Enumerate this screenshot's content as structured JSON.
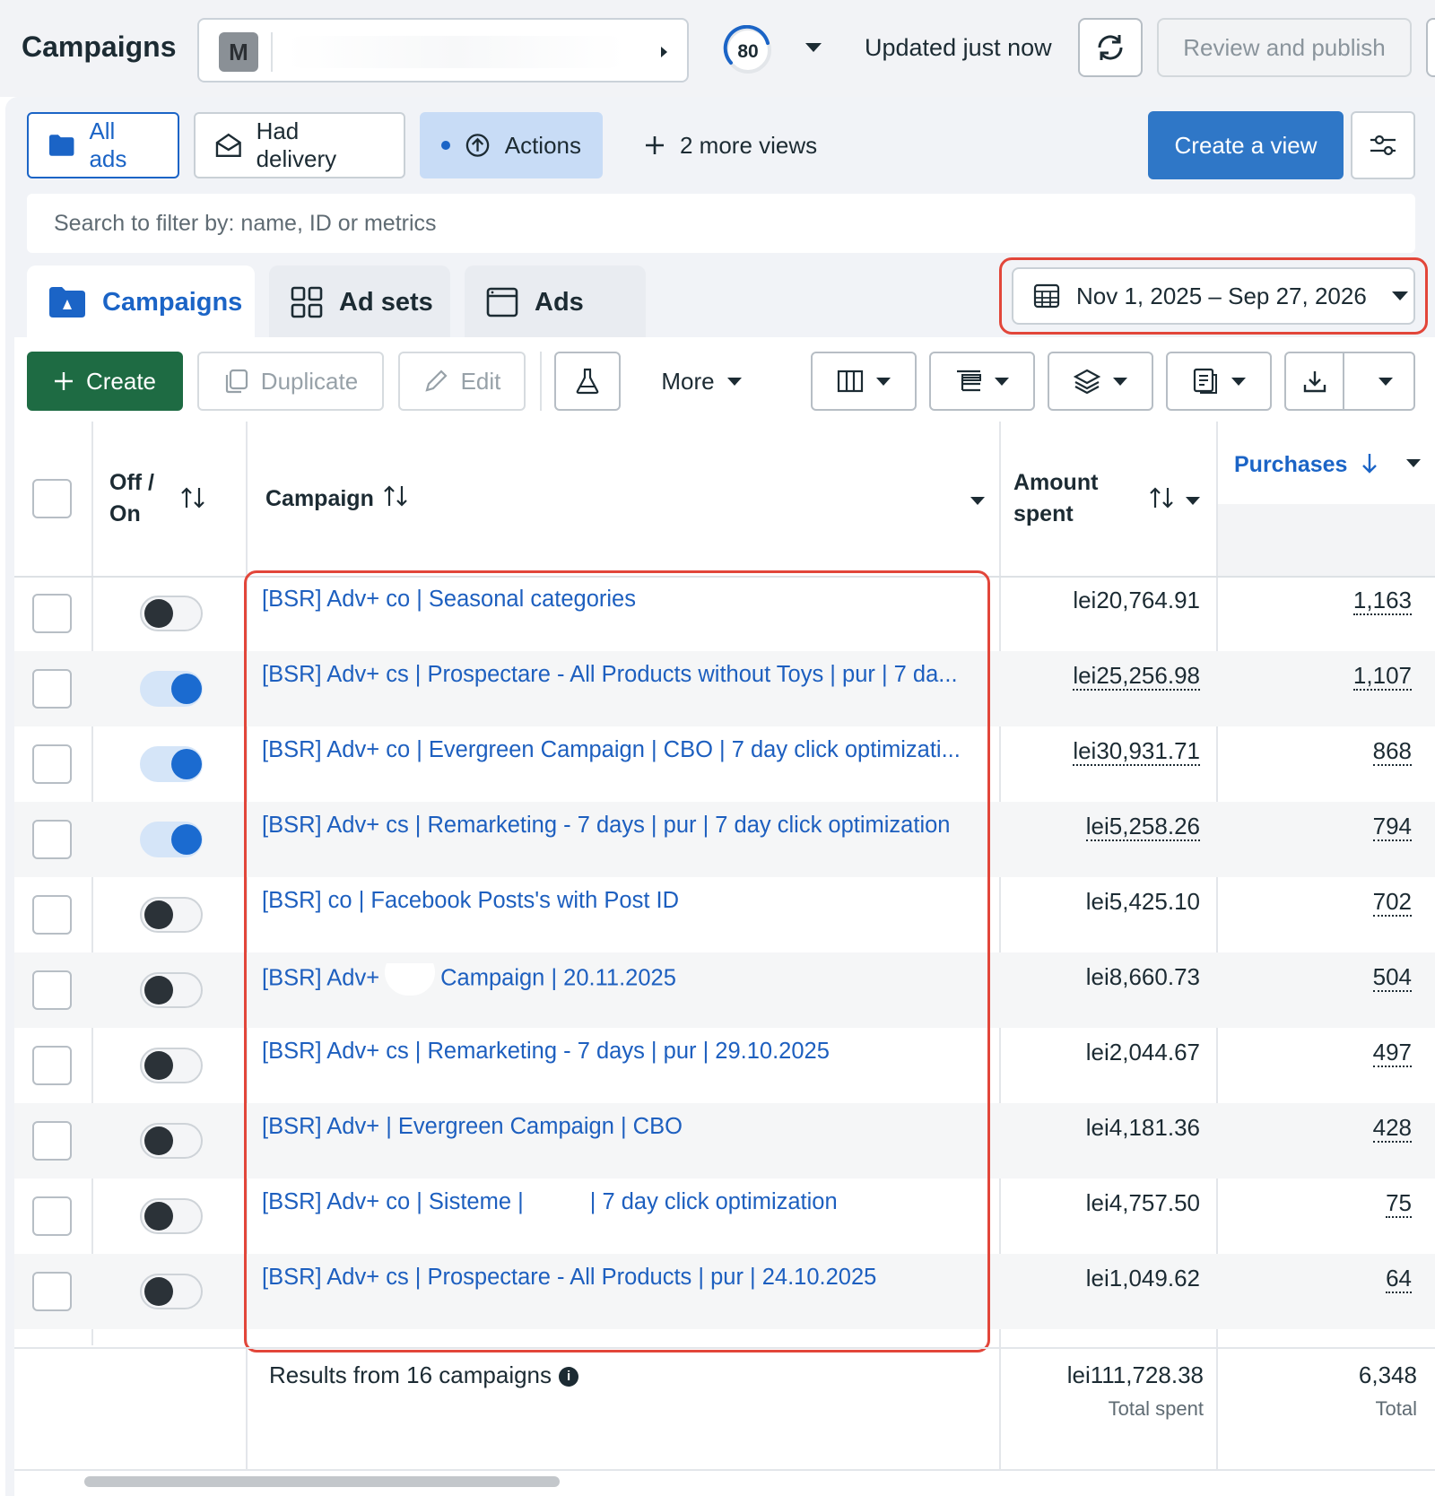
{
  "header": {
    "title": "Campaigns",
    "account_initial": "M",
    "score": "80",
    "updated_text": "Updated just now",
    "review_publish_label": "Review and publish"
  },
  "views": {
    "all_ads": "All ads",
    "had_delivery": "Had delivery",
    "actions": "Actions",
    "more_views": "2 more views",
    "create_view": "Create a view"
  },
  "search": {
    "placeholder": "Search to filter by: name, ID or metrics"
  },
  "level_tabs": {
    "campaigns": "Campaigns",
    "ad_sets": "Ad sets",
    "ads": "Ads"
  },
  "date_range": "Nov 1, 2025 – Sep 27, 2026",
  "toolbar": {
    "create": "Create",
    "duplicate": "Duplicate",
    "edit": "Edit",
    "more": "More"
  },
  "table": {
    "headers": {
      "off_on_line1": "Off /",
      "off_on_line2": "On",
      "campaign": "Campaign",
      "amount_line1": "Amount",
      "amount_line2": "spent",
      "purchases": "Purchases"
    },
    "rows": [
      {
        "on": false,
        "name": "[BSR] Adv+ co | Seasonal categories",
        "amount": "lei20,764.91",
        "purchases": "1,163"
      },
      {
        "on": true,
        "name": "[BSR] Adv+ cs | Prospectare - All Products without Toys | pur | 7 da...",
        "amount": "lei25,256.98",
        "purchases": "1,107"
      },
      {
        "on": true,
        "name": "[BSR] Adv+ co | Evergreen Campaign | CBO | 7 day click optimizati...",
        "amount": "lei30,931.71",
        "purchases": "868"
      },
      {
        "on": true,
        "name": "[BSR] Adv+ cs | Remarketing - 7 days | pur | 7 day click optimization",
        "amount": "lei5,258.26",
        "purchases": "794"
      },
      {
        "on": false,
        "name": "[BSR] co | Facebook Posts's with Post ID",
        "amount": "lei5,425.10",
        "purchases": "702"
      },
      {
        "on": false,
        "name_a": "[BSR] Adv+",
        "name_b": "Campaign | 20.11.2025",
        "amount": "lei8,660.73",
        "purchases": "504"
      },
      {
        "on": false,
        "name": "[BSR] Adv+ cs | Remarketing - 7 days | pur | 29.10.2025",
        "amount": "lei2,044.67",
        "purchases": "497"
      },
      {
        "on": false,
        "name": "[BSR] Adv+ | Evergreen Campaign | CBO",
        "amount": "lei4,181.36",
        "purchases": "428"
      },
      {
        "on": false,
        "name_a": "[BSR] Adv+ co | Sisteme |",
        "name_b": "| 7 day click optimization",
        "amount": "lei4,757.50",
        "purchases": "75"
      },
      {
        "on": false,
        "name": "[BSR] Adv+ cs | Prospectare - All Products | pur | 24.10.2025",
        "amount": "lei1,049.62",
        "purchases": "64"
      }
    ],
    "footer": {
      "results": "Results from 16 campaigns",
      "total_spent": "lei111,728.38",
      "total_spent_label": "Total spent",
      "total_purchases": "6,348",
      "total_purchases_label": "Total"
    }
  },
  "colors": {
    "link": "#1d5fbf",
    "primary_button": "#2f77c7",
    "create_button": "#1e6b43",
    "highlight": "#e2463a",
    "toggle_on": "#1b6bd0"
  }
}
